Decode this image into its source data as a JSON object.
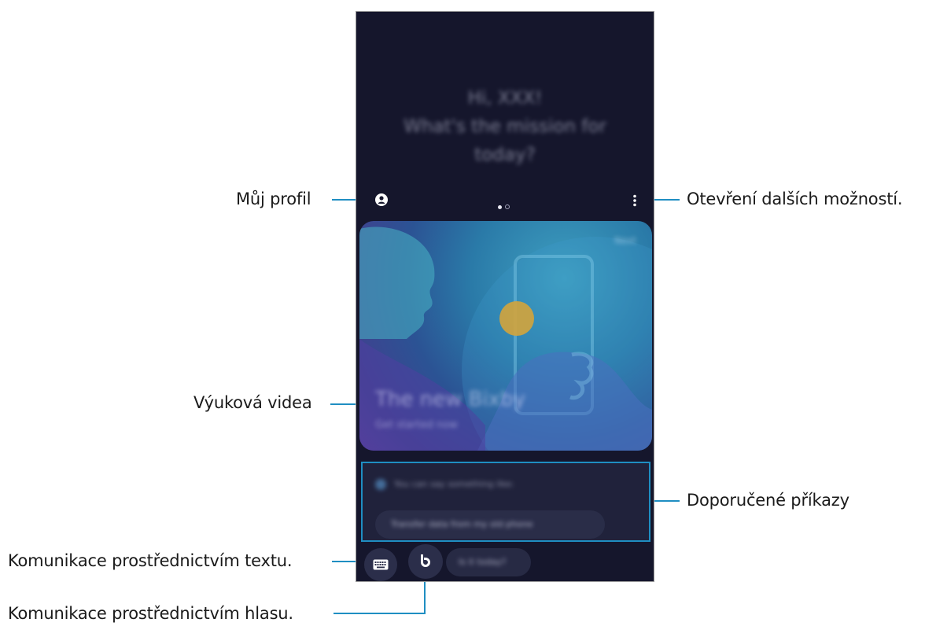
{
  "callouts": {
    "profile": "Můj profil",
    "more_options": "Otevření dalších možností.",
    "tutorial_videos": "Výuková videa",
    "suggested_commands": "Doporučené příkazy",
    "text_communication": "Komunikace prostřednictvím textu.",
    "voice_communication": "Komunikace prostřednictvím hlasu."
  },
  "screen": {
    "greeting_line1": "Hi, XXX!",
    "greeting_line2": "What's the mission for",
    "greeting_line3": "today?",
    "page_indicator": {
      "count": 2,
      "active": 0
    },
    "card": {
      "corner_label": "Next",
      "title": "The new Bixby",
      "subtitle": "Get started now"
    },
    "suggestions": {
      "header": "You can say something like:",
      "chip": "Transfer data from my old phone"
    },
    "bottom_chip": "Is it today?"
  },
  "colors": {
    "callout_line": "#1f8ec2",
    "phone_bg": "#15162c"
  },
  "icons": {
    "profile": "profile-icon",
    "more": "more-options-icon",
    "keyboard": "keyboard-icon",
    "bixby": "bixby-icon"
  }
}
